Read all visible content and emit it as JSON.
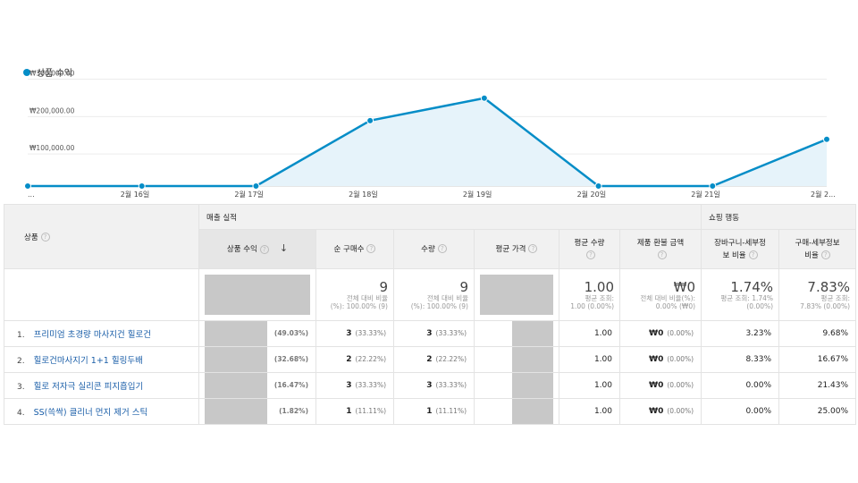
{
  "chart_data": {
    "type": "area",
    "legend": "상품 수익",
    "y_ticks": [
      "₩300,000.00",
      "₩200,000.00",
      "₩100,000.00"
    ],
    "ylim": [
      0,
      330000
    ],
    "grid": true,
    "x_labels": [
      "...",
      "2월 16일",
      "2월 17일",
      "2월 18일",
      "2월 19일",
      "2월 20일",
      "2월 21일",
      "2월 2..."
    ],
    "values": [
      0,
      0,
      0,
      175000,
      235000,
      0,
      0,
      125000
    ],
    "line_color": "#058dc7",
    "fill_color": "#e6f3fa"
  },
  "table": {
    "dimension_header": "상품",
    "group_sales": "매출 실적",
    "group_shopping": "쇼핑 행동",
    "col_revenue": "상품 수익",
    "col_unique_purchases": "순 구매수",
    "col_quantity": "수량",
    "col_avg_price": "평균 가격",
    "col_avg_qty": "평균 수량",
    "col_refund": "제품 환불 금액",
    "col_cart_to_detail_1": "장바구니-세부정",
    "col_cart_to_detail_2": "보 비율",
    "col_buy_to_detail_1": "구매-세부정보",
    "col_buy_to_detail_2": "비율",
    "help_glyph": "?",
    "sort_glyph": "↓",
    "totals": {
      "unique_purchases": "9",
      "unique_purchases_sub1": "전체 대비 비율",
      "unique_purchases_sub2": "(%): 100.00% (9)",
      "quantity": "9",
      "quantity_sub1": "전체 대비 비율",
      "quantity_sub2": "(%): 100.00% (9)",
      "avg_qty": "1.00",
      "avg_qty_sub1": "평균 조회:",
      "avg_qty_sub2": "1.00 (0.00%)",
      "refund": "₩0",
      "refund_sub1": "전체 대비 비율(%):",
      "refund_sub2": "0.00% (₩0)",
      "cart_ratio": "1.74%",
      "cart_ratio_sub1": "평균 조회: 1.74%",
      "cart_ratio_sub2": "(0.00%)",
      "buy_ratio": "7.83%",
      "buy_ratio_sub1": "평균 조회:",
      "buy_ratio_sub2": "7.83% (0.00%)"
    },
    "rows": [
      {
        "num": "1.",
        "name": "프리미엄 초경량 마사지건 힐로건",
        "rev_pct": "(49.03%)",
        "up": "3",
        "up_pct": "(33.33%)",
        "qty": "3",
        "qty_pct": "(33.33%)",
        "avg_qty": "1.00",
        "refund": "₩0",
        "refund_pct": "(0.00%)",
        "cart": "3.23%",
        "buy": "9.68%"
      },
      {
        "num": "2.",
        "name": "힐로건마사지기 1+1 힐링두배",
        "rev_pct": "(32.68%)",
        "up": "2",
        "up_pct": "(22.22%)",
        "qty": "2",
        "qty_pct": "(22.22%)",
        "avg_qty": "1.00",
        "refund": "₩0",
        "refund_pct": "(0.00%)",
        "cart": "8.33%",
        "buy": "16.67%"
      },
      {
        "num": "3.",
        "name": "힐로 저자극 실리콘 피지흡입기",
        "rev_pct": "(16.47%)",
        "up": "3",
        "up_pct": "(33.33%)",
        "qty": "3",
        "qty_pct": "(33.33%)",
        "avg_qty": "1.00",
        "refund": "₩0",
        "refund_pct": "(0.00%)",
        "cart": "0.00%",
        "buy": "21.43%"
      },
      {
        "num": "4.",
        "name": "SS(쓱싹) 클리너 먼지 제거 스틱",
        "rev_pct": "(1.82%)",
        "up": "1",
        "up_pct": "(11.11%)",
        "qty": "1",
        "qty_pct": "(11.11%)",
        "avg_qty": "1.00",
        "refund": "₩0",
        "refund_pct": "(0.00%)",
        "cart": "0.00%",
        "buy": "25.00%"
      }
    ]
  }
}
